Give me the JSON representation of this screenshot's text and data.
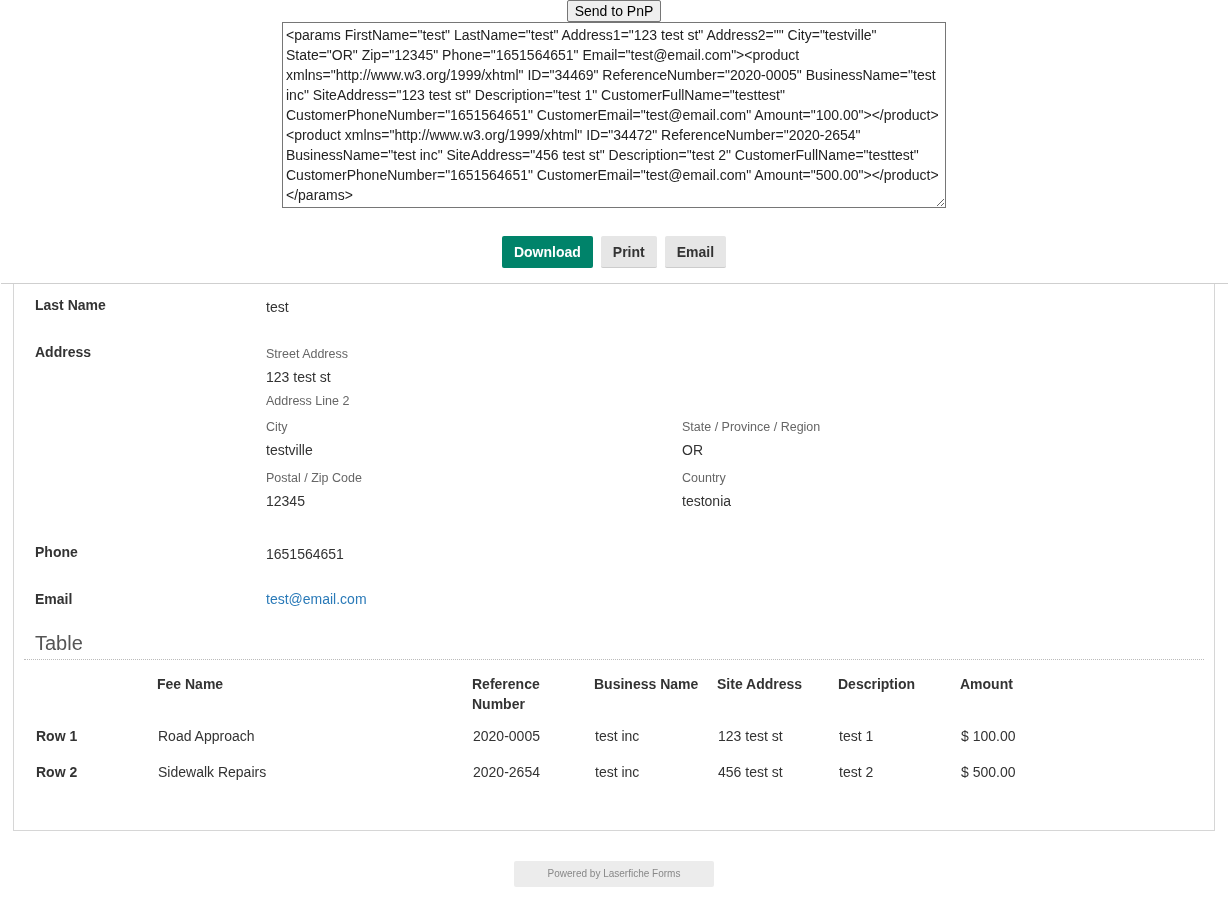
{
  "send_button": "Send to PnP",
  "xml_text": "<params FirstName=\"test\" LastName=\"test\" Address1=\"123 test st\" Address2=\"\" City=\"testville\" State=\"OR\" Zip=\"12345\" Phone=\"1651564651\" Email=\"test@email.com\"><product xmlns=\"http://www.w3.org/1999/xhtml\" ID=\"34469\" ReferenceNumber=\"2020-0005\" BusinessName=\"test inc\" SiteAddress=\"123 test st\" Description=\"test 1\" CustomerFullName=\"testtest\" CustomerPhoneNumber=\"1651564651\" CustomerEmail=\"test@email.com\" Amount=\"100.00\"></product><product xmlns=\"http://www.w3.org/1999/xhtml\" ID=\"34472\" ReferenceNumber=\"2020-2654\" BusinessName=\"test inc\" SiteAddress=\"456 test st\" Description=\"test 2\" CustomerFullName=\"testtest\" CustomerPhoneNumber=\"1651564651\" CustomerEmail=\"test@email.com\" Amount=\"500.00\"></product></params>",
  "actions": [
    {
      "label": "Download",
      "kind": "primary"
    },
    {
      "label": "Print",
      "kind": "secondary"
    },
    {
      "label": "Email",
      "kind": "secondary"
    }
  ],
  "fields": [
    {
      "label": "Last Name",
      "kind": "text",
      "value": "test"
    },
    {
      "label": "Address",
      "kind": "address",
      "lines": [
        {
          "label": "Street Address",
          "value": "123 test st"
        },
        {
          "label": "Address Line 2"
        }
      ],
      "grid": [
        {
          "label": "City",
          "value": "testville"
        },
        {
          "label": "State / Province / Region",
          "value": "OR"
        },
        {
          "label": "Postal / Zip Code",
          "value": "12345"
        },
        {
          "label": "Country",
          "value": "testonia"
        }
      ]
    },
    {
      "label": "Phone",
      "kind": "text",
      "value": "1651564651"
    },
    {
      "label": "Email",
      "kind": "link",
      "value": "test@email.com"
    }
  ],
  "table": {
    "title": "Table",
    "columns": [
      "Fee Name",
      "Reference Number",
      "Business Name",
      "Site Address",
      "Description",
      "Amount"
    ],
    "rows": [
      {
        "label": "Row 1",
        "cells": [
          "Road Approach",
          "2020-0005",
          "test inc",
          "123 test st",
          "test 1",
          "$ 100.00"
        ]
      },
      {
        "label": "Row 2",
        "cells": [
          "Sidewalk Repairs",
          "2020-2654",
          "test inc",
          "456 test st",
          "test 2",
          "$ 500.00"
        ]
      }
    ]
  },
  "footer": "Powered by Laserfiche Forms"
}
